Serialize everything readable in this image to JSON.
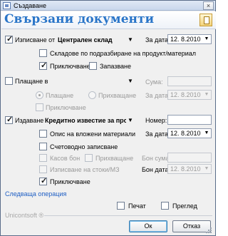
{
  "window": {
    "title": "Създаване",
    "close_glyph": "×",
    "header_title": "Свързани документи",
    "header_icon": "document-icon"
  },
  "issued_from": {
    "checkbox_checked": true,
    "label": "Изписване от",
    "value": "Централен склад",
    "date_label": "За дата:",
    "date_value": "12. 8.2010",
    "default_store_label": "Складове по подразбиране на продукт/материал",
    "default_store_checked": false,
    "posting_label": "Приключване",
    "posting_checked": true,
    "reserve_label": "Запазване",
    "reserve_checked": false
  },
  "payment": {
    "checkbox_checked": false,
    "label": "Плащане в",
    "value": "",
    "sum_label": "Сума:",
    "sum_value": "",
    "payout_label": "Плащане",
    "payout_selected": true,
    "receipt_label": "Прихващане",
    "receipt_selected": false,
    "date_label": "За дата:",
    "date_value": "12. 8.2010",
    "posting_label": "Приключване",
    "posting_checked": false
  },
  "issue": {
    "checkbox_checked": true,
    "label": "Издаване",
    "value": "Кредитно известие за прода:",
    "number_label": "Номер:",
    "number_value": "",
    "materials_label": "Опис на вложени материали",
    "materials_checked": false,
    "date_label": "За дата:",
    "date_value": "12. 8.2010",
    "accounting_label": "Счетоводно записване",
    "accounting_checked": false,
    "cash_receipt_label": "Касов бон",
    "cash_receipt_checked": false,
    "offset_label": "Прихващане",
    "offset_checked": false,
    "receipt_sum_label": "Бон сума:",
    "receipt_sum_value": "",
    "goods_issue_label": "Изписване на стоки/МЗ",
    "goods_issue_checked": false,
    "date2_label": "Бон дата:",
    "date2_value": "12. 8.2010",
    "posting_label": "Приключване",
    "posting_checked": true
  },
  "next_operation_link": "Следваща операция",
  "footer": {
    "brand": "Unicontsoft ®",
    "print_label": "Печат",
    "print_checked": false,
    "preview_label": "Преглед",
    "preview_checked": false,
    "ok_label": "Ок",
    "cancel_label": "Отказ"
  }
}
